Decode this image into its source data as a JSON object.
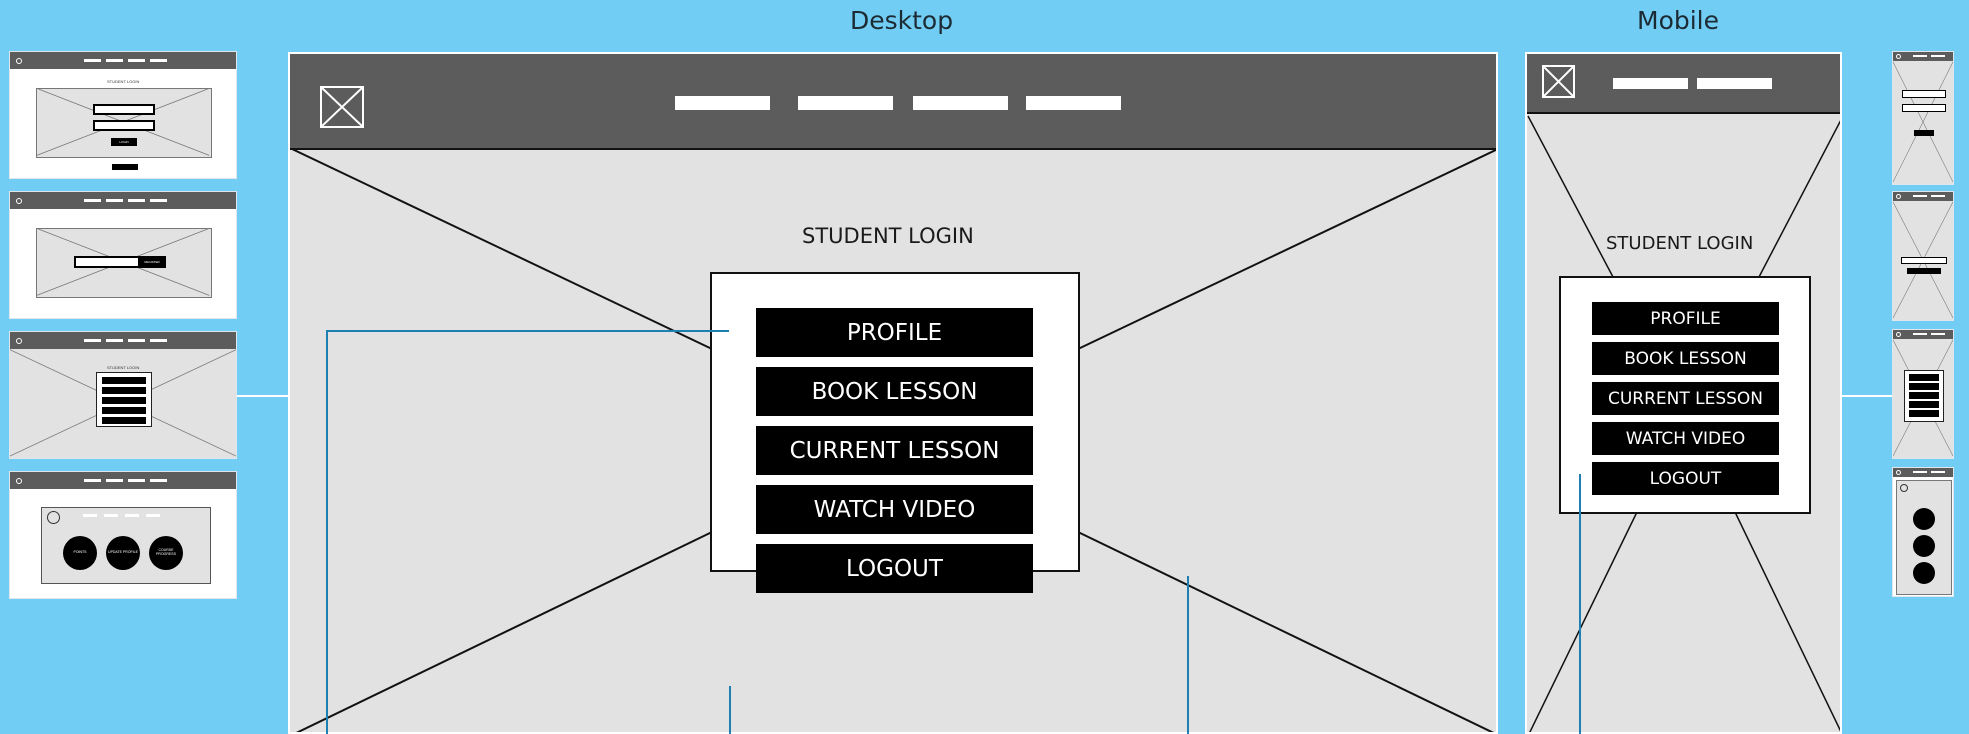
{
  "labels": {
    "desktop": "Desktop",
    "mobile": "Mobile"
  },
  "login": {
    "title": "STUDENT LOGIN",
    "buttons": [
      "PROFILE",
      "BOOK LESSON",
      "CURRENT LESSON",
      "WATCH VIDEO",
      "LOGOUT"
    ]
  },
  "thumbs": {
    "t1_title": "STUDENT LOGIN",
    "t1_btn": "LOGIN",
    "t2_btn": "REGISTER",
    "t3_title": "STUDENT LOGIN",
    "t3_buttons": [
      "PROFILE",
      "BOOK LESSON",
      "CURRENT LESSON",
      "WATCH VIDEO",
      "LOGOUT"
    ],
    "t4_circles": [
      "POINTS",
      "UPDATE PROFILE",
      "COURSE PROGRESS"
    ]
  },
  "colors": {
    "background": "#72cdf4",
    "header": "#5c5c5c",
    "canvas": "#e2e2e2",
    "callout": "#1f7fb0"
  }
}
